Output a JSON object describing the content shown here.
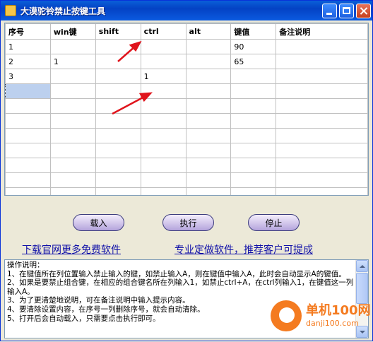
{
  "window": {
    "title": "大漠驼铃禁止按键工具",
    "minimize": "minimize",
    "maximize": "maximize",
    "close": "close"
  },
  "grid": {
    "columns": [
      "序号",
      "win键",
      "shift",
      "ctrl",
      "alt",
      "键值",
      "备注说明"
    ],
    "rows": [
      [
        "1",
        "",
        "",
        "",
        "",
        "90",
        ""
      ],
      [
        "2",
        "1",
        "",
        "",
        "",
        "65",
        ""
      ],
      [
        "3",
        "",
        "",
        "1",
        "",
        "",
        ""
      ],
      [
        "",
        "",
        "",
        "",
        "",
        "",
        ""
      ],
      [
        "",
        "",
        "",
        "",
        "",
        "",
        ""
      ],
      [
        "",
        "",
        "",
        "",
        "",
        "",
        ""
      ],
      [
        "",
        "",
        "",
        "",
        "",
        "",
        ""
      ],
      [
        "",
        "",
        "",
        "",
        "",
        "",
        ""
      ],
      [
        "",
        "",
        "",
        "",
        "",
        "",
        ""
      ],
      [
        "",
        "",
        "",
        "",
        "",
        "",
        ""
      ],
      [
        "",
        "",
        "",
        "",
        "",
        "",
        ""
      ]
    ],
    "selected_row": 3,
    "selected_col": 0
  },
  "buttons": {
    "load": "载入",
    "run": "执行",
    "stop": "停止"
  },
  "links": {
    "download": "下载官网更多免费软件",
    "custom": "专业定做软件，推荐客户可提成"
  },
  "info": {
    "lines": [
      "操作说明：",
      "1、在键值所在列位置输入禁止输入的键，如禁止输入A，则在键值中输入A，此时会自动显示A的键值。",
      "2、如果是要禁止组合键，在相应的组合键名所在列输入1，如禁止ctrl+A，在ctrl列输入1，在键值这一列输入A。",
      "3、为了更清楚地说明，可在备注说明中输入提示内容。",
      "4、要清除设置内容，在序号一列删除序号，就会自动清除。",
      "5、打开后会自动载入，只需要点击执行即可。"
    ]
  },
  "watermark": {
    "brand": "单机100网",
    "sub": "danji100.com"
  },
  "colors": {
    "title_bar": "#0a5fd8",
    "arrow": "#e0141c",
    "link": "#1010a8",
    "watermark": "#f47b20"
  }
}
